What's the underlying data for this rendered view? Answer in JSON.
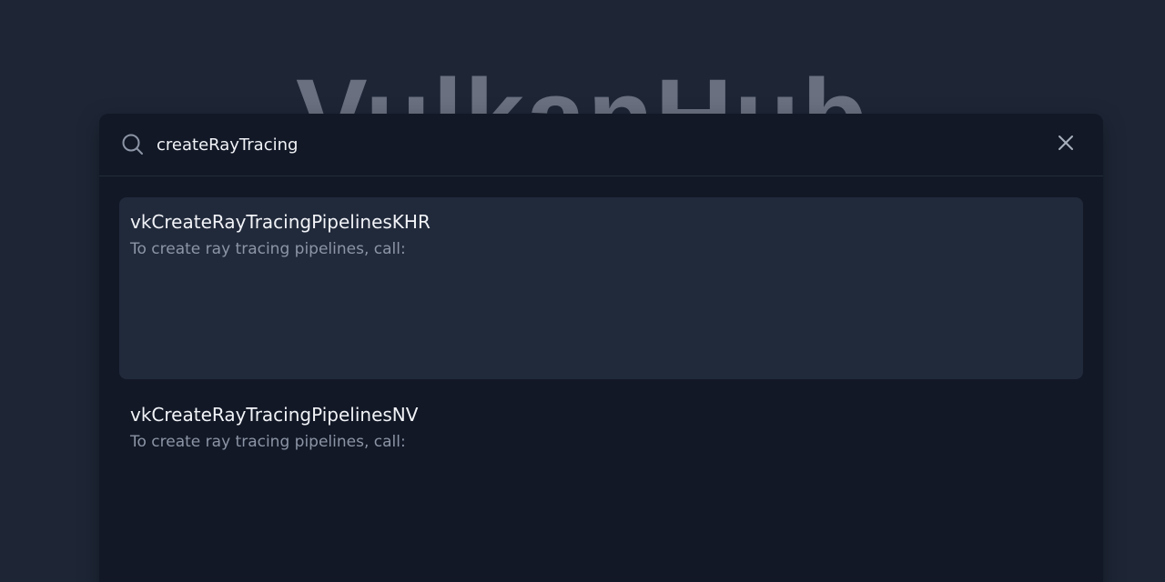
{
  "background": {
    "title": "VulkanHub"
  },
  "search": {
    "value": "createRayTracing",
    "icon": "search-icon",
    "close_icon": "close-icon"
  },
  "results": [
    {
      "title": "vkCreateRayTracingPipelinesKHR",
      "description": "To create ray tracing pipelines, call:",
      "active": true
    },
    {
      "title": "vkCreateRayTracingPipelinesNV",
      "description": "To create ray tracing pipelines, call:",
      "active": false
    }
  ],
  "colors": {
    "page_background": "#1e2636",
    "modal_background": "#121826",
    "active_result_background": "#212a3b",
    "spellcheck_underline": "#e33b3b"
  }
}
